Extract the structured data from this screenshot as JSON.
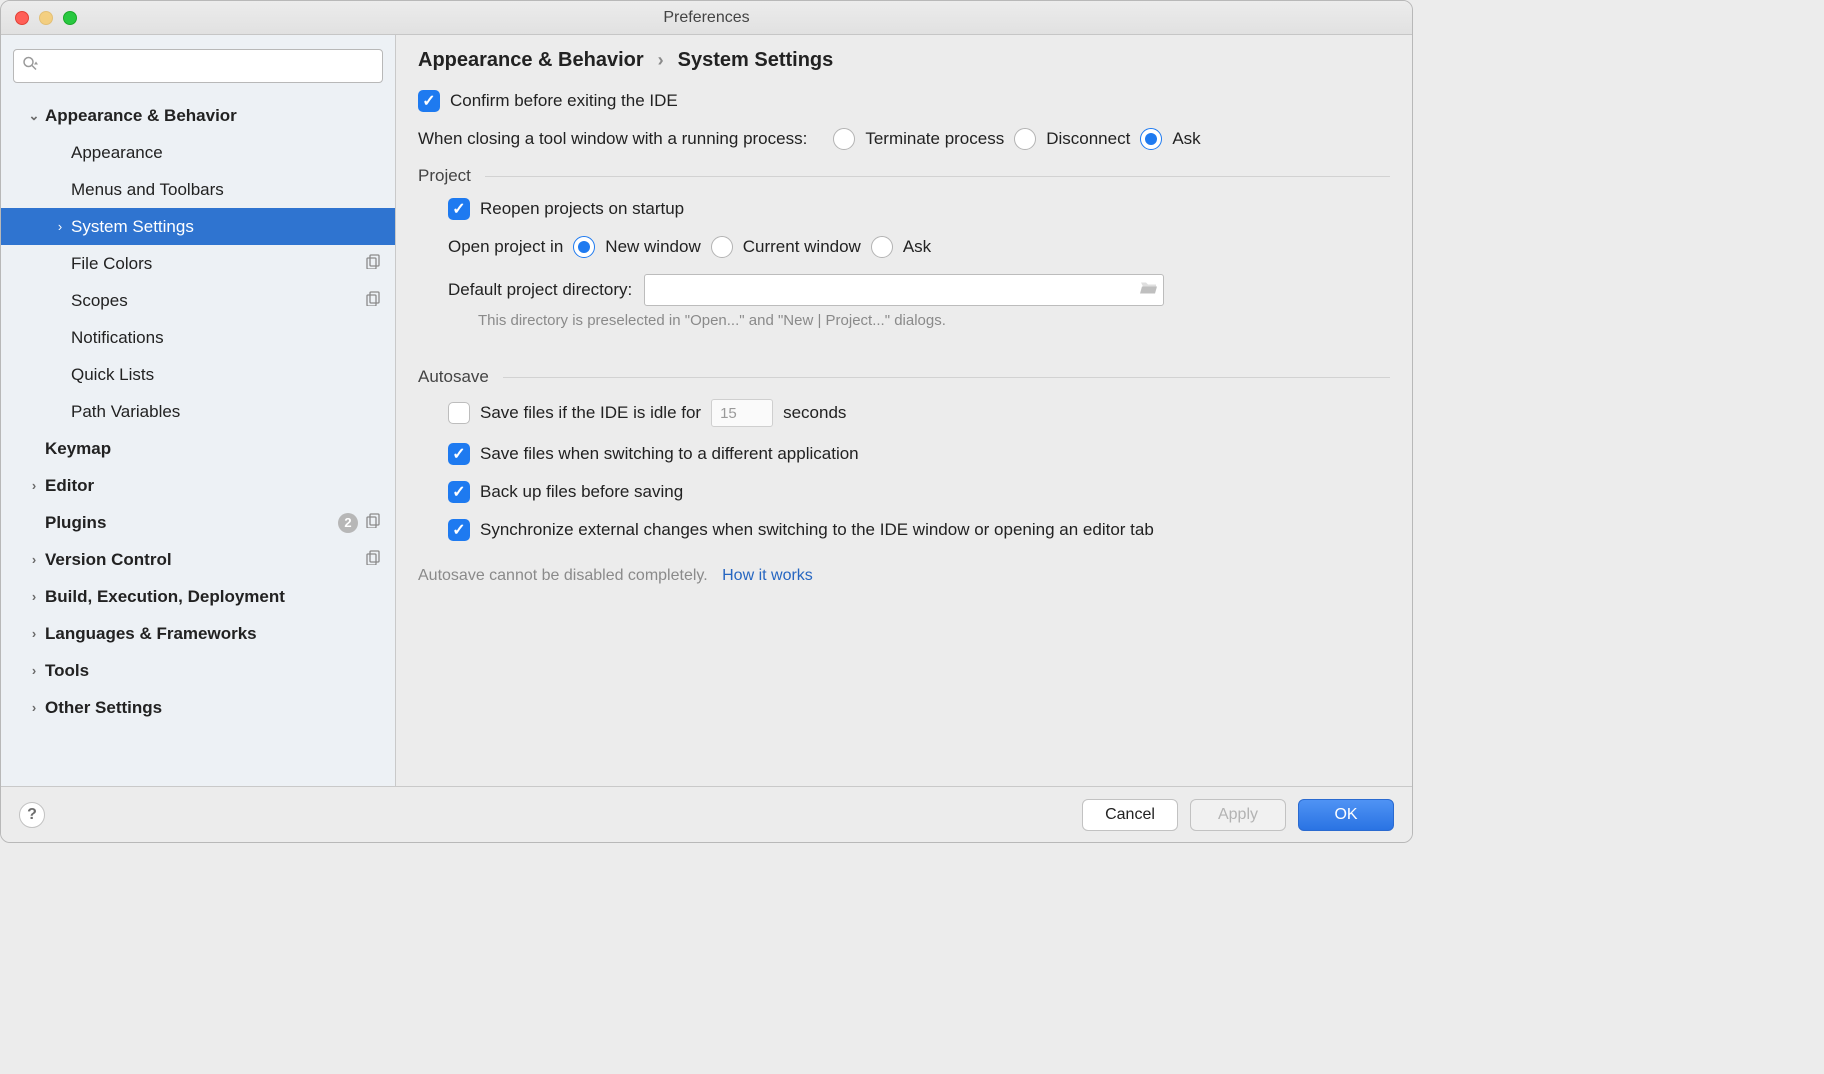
{
  "window": {
    "title": "Preferences"
  },
  "search": {
    "placeholder": ""
  },
  "sidebar": {
    "items": [
      {
        "label": "Appearance & Behavior",
        "bold": true,
        "expander": "down",
        "indent": 1
      },
      {
        "label": "Appearance",
        "indent": 2
      },
      {
        "label": "Menus and Toolbars",
        "indent": 2
      },
      {
        "label": "System Settings",
        "expander": "right",
        "indent": 2,
        "selected": true
      },
      {
        "label": "File Colors",
        "indent": 2,
        "copy": true
      },
      {
        "label": "Scopes",
        "indent": 2,
        "copy": true
      },
      {
        "label": "Notifications",
        "indent": 2
      },
      {
        "label": "Quick Lists",
        "indent": 2
      },
      {
        "label": "Path Variables",
        "indent": 2
      },
      {
        "label": "Keymap",
        "bold": true,
        "indent": 1
      },
      {
        "label": "Editor",
        "bold": true,
        "expander": "right",
        "indent": 1
      },
      {
        "label": "Plugins",
        "bold": true,
        "indent": 1,
        "badge": "2",
        "copy": true
      },
      {
        "label": "Version Control",
        "bold": true,
        "expander": "right",
        "indent": 1,
        "copy": true
      },
      {
        "label": "Build, Execution, Deployment",
        "bold": true,
        "expander": "right",
        "indent": 1
      },
      {
        "label": "Languages & Frameworks",
        "bold": true,
        "expander": "right",
        "indent": 1
      },
      {
        "label": "Tools",
        "bold": true,
        "expander": "right",
        "indent": 1
      },
      {
        "label": "Other Settings",
        "bold": true,
        "expander": "right",
        "indent": 1
      }
    ]
  },
  "breadcrumb": {
    "a": "Appearance & Behavior",
    "b": "System Settings",
    "sep": "›"
  },
  "main": {
    "confirm_exit": {
      "label": "Confirm before exiting the IDE",
      "checked": true
    },
    "closing_tool": {
      "label": "When closing a tool window with a running process:",
      "options": [
        {
          "label": "Terminate process",
          "checked": false
        },
        {
          "label": "Disconnect",
          "checked": false
        },
        {
          "label": "Ask",
          "checked": true
        }
      ]
    },
    "project": {
      "title": "Project",
      "reopen": {
        "label": "Reopen projects on startup",
        "checked": true
      },
      "open_in": {
        "label": "Open project in",
        "options": [
          {
            "label": "New window",
            "checked": true
          },
          {
            "label": "Current window",
            "checked": false
          },
          {
            "label": "Ask",
            "checked": false
          }
        ]
      },
      "dir_label": "Default project directory:",
      "dir_value": "",
      "dir_hint": "This directory is preselected in \"Open...\" and \"New | Project...\" dialogs."
    },
    "autosave": {
      "title": "Autosave",
      "idle": {
        "checked": false,
        "pre": "Save files if the IDE is idle for",
        "value": "15",
        "post": "seconds"
      },
      "switch_app": {
        "label": "Save files when switching to a different application",
        "checked": true
      },
      "backup": {
        "label": "Back up files before saving",
        "checked": true
      },
      "sync": {
        "label": "Synchronize external changes when switching to the IDE window or opening an editor tab",
        "checked": true
      },
      "note": "Autosave cannot be disabled completely.",
      "link": "How it works"
    }
  },
  "footer": {
    "cancel": "Cancel",
    "apply": "Apply",
    "ok": "OK",
    "help": "?"
  }
}
